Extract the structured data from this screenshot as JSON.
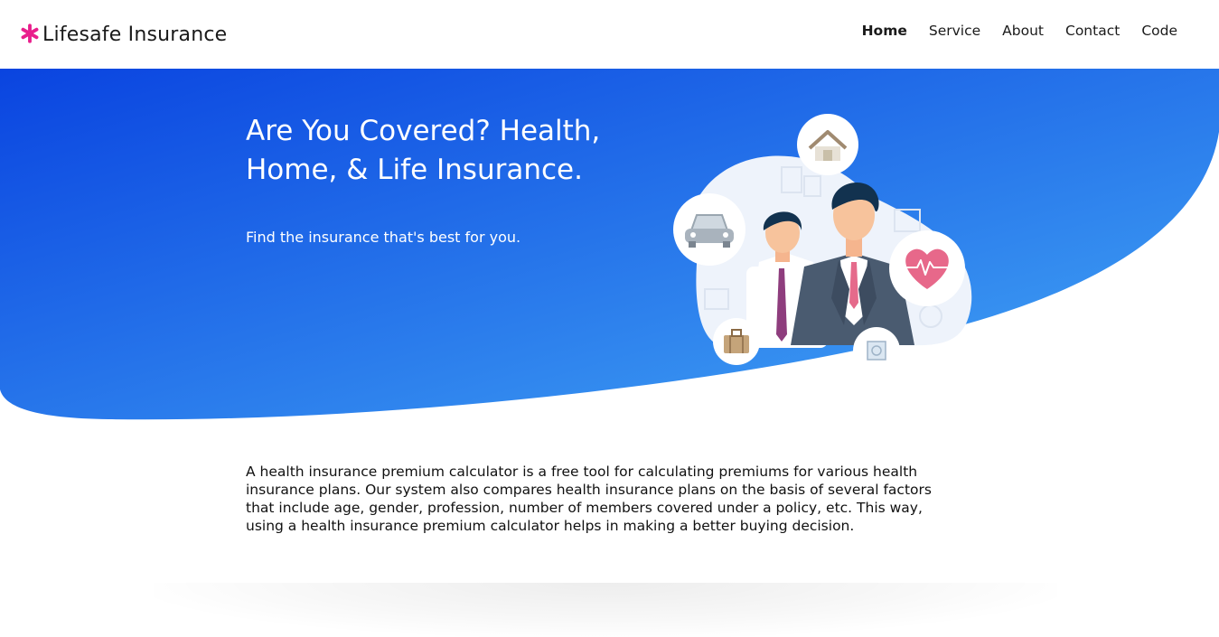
{
  "brand": {
    "name": "Lifesafe Insurance",
    "icon": "asterisk-icon",
    "icon_color": "#e91e8c"
  },
  "nav": {
    "items": [
      {
        "label": "Home",
        "active": true
      },
      {
        "label": "Service",
        "active": false
      },
      {
        "label": "About",
        "active": false
      },
      {
        "label": "Contact",
        "active": false
      },
      {
        "label": "Code",
        "active": false
      }
    ]
  },
  "hero": {
    "title": "Are You Covered? Health, Home, & Life Insurance.",
    "subtitle": "Find the insurance that's best for you.",
    "gradient_start": "#0a44e0",
    "gradient_end": "#44a8f5",
    "illustration_icons": [
      "house-icon",
      "car-icon",
      "heart-pulse-icon",
      "briefcase-icon",
      "safe-icon"
    ]
  },
  "intro": {
    "text": "A health insurance premium calculator is a free tool for calculating premiums for various health insurance plans. Our system also compares health insurance plans on the basis of several factors that include age, gender, profession, number of members covered under a policy, etc. This way, using a health insurance premium calculator helps in making a better buying decision."
  }
}
